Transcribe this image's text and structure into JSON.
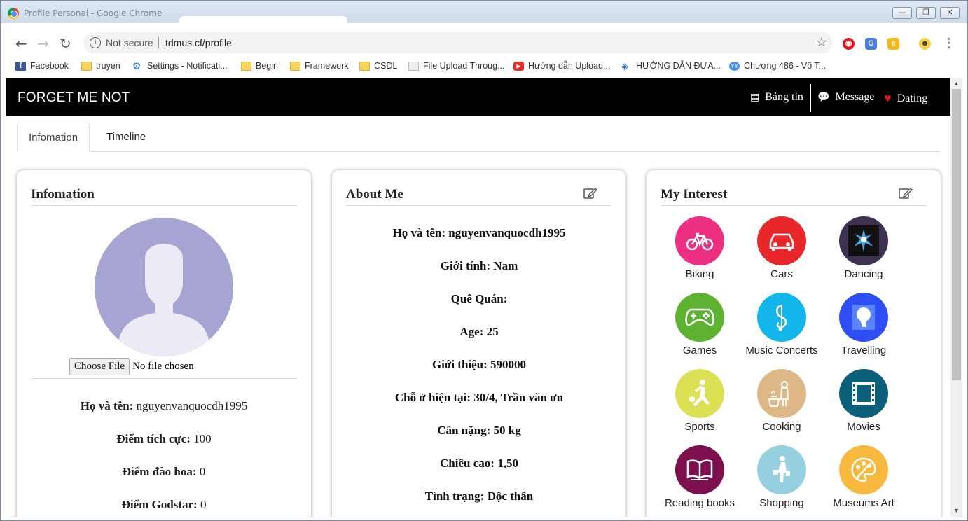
{
  "window": {
    "title": "Profile Personal - Google Chrome",
    "minimize": "—",
    "maximize": "❐",
    "close": "✕"
  },
  "browser": {
    "security": "Not secure",
    "url": "tdmus.cf/profile",
    "bookmarks": [
      {
        "label": "Facebook",
        "icon": "facebook-icon"
      },
      {
        "label": "truyen",
        "icon": "folder-icon"
      },
      {
        "label": "Settings - Notificati...",
        "icon": "gear-icon"
      },
      {
        "label": "Begin",
        "icon": "folder-icon"
      },
      {
        "label": "Framework",
        "icon": "folder-icon"
      },
      {
        "label": "CSDL",
        "icon": "folder-icon"
      },
      {
        "label": "File Upload Throug...",
        "icon": "page-icon"
      },
      {
        "label": "Hướng dẫn Upload...",
        "icon": "youtube-icon"
      },
      {
        "label": "HƯỚNG DẪN ĐƯA...",
        "icon": "diamond-icon"
      },
      {
        "label": "Chương 486 - Võ T...",
        "icon": "yy-icon"
      }
    ]
  },
  "navbar": {
    "brand": "FORGET ME NOT",
    "links": [
      {
        "label": "Bảng tin",
        "icon": "newspaper-icon"
      },
      {
        "label": "Message",
        "icon": "chat-icon"
      },
      {
        "label": "Dating",
        "icon": "heart-icon"
      }
    ]
  },
  "tabs": [
    "Infomation",
    "Timeline"
  ],
  "info_card": {
    "title": "Infomation",
    "choose_file": "Choose File",
    "no_file": "No file chosen",
    "fields": [
      {
        "label": "Họ và tên:",
        "value": " nguyenvanquocdh1995"
      },
      {
        "label": "Điểm tích cực:",
        "value": " 100"
      },
      {
        "label": "Điểm đào hoa:",
        "value": " 0"
      },
      {
        "label": "Điểm Godstar:",
        "value": " 0"
      }
    ]
  },
  "about_card": {
    "title": "About Me",
    "lines": [
      "Họ và tên: nguyenvanquocdh1995",
      "Giới tính: Nam",
      "Quê Quán:",
      "Age: 25",
      "Giới thiệu: 590000",
      "Chỗ ở hiện tại: 30/4, Trần văn ơn",
      "Cân nặng: 50 kg",
      "Chiều cao: 1,50",
      "Tình trạng: Độc thân"
    ]
  },
  "interest_card": {
    "title": "My Interest",
    "items": [
      {
        "label": "Biking",
        "color": "#ec2f80",
        "icon": "bicycle-icon"
      },
      {
        "label": "Cars",
        "color": "#e8272b",
        "icon": "car-icon"
      },
      {
        "label": "Dancing",
        "color": "#3f3152",
        "icon": "dancer-icon"
      },
      {
        "label": "Games",
        "color": "#5db232",
        "icon": "gamepad-icon"
      },
      {
        "label": "Music Concerts",
        "color": "#12b6ea",
        "icon": "music-note-icon"
      },
      {
        "label": "Travelling",
        "color": "#2d4ef4",
        "icon": "balloon-icon"
      },
      {
        "label": "Sports",
        "color": "#dce055",
        "icon": "soccer-player-icon"
      },
      {
        "label": "Cooking",
        "color": "#ddb886",
        "icon": "chef-icon"
      },
      {
        "label": "Movies",
        "color": "#0c5f78",
        "icon": "film-icon"
      },
      {
        "label": "Reading books",
        "color": "#7c0f4d",
        "icon": "book-icon"
      },
      {
        "label": "Shopping",
        "color": "#95cfe0",
        "icon": "shopper-icon"
      },
      {
        "label": "Museums Art",
        "color": "#f7b83e",
        "icon": "palette-icon"
      }
    ]
  }
}
